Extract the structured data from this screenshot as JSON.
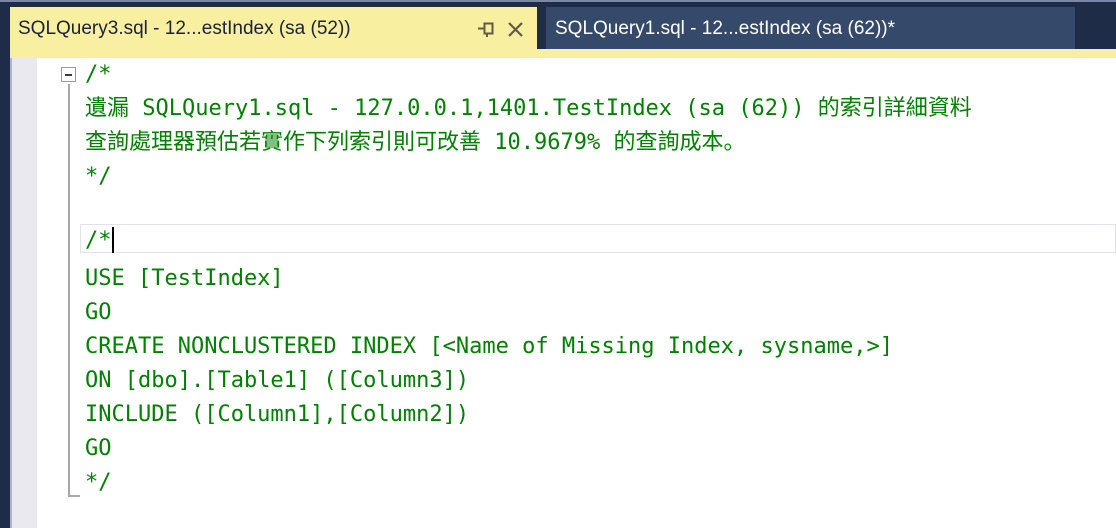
{
  "tabs": [
    {
      "label": "SQLQuery3.sql - 12...estIndex (sa (52))",
      "state": "active",
      "pin_icon": "pin-icon",
      "close_icon": "close-icon"
    },
    {
      "label": "SQLQuery1.sql - 12...estIndex (sa (62))*",
      "state": "inactive"
    }
  ],
  "colors": {
    "active_tab_bg": "#f8efa1",
    "inactive_tab_bg": "#35496b",
    "tab_well_bg": "#1e2c48",
    "comment_green": "#008000",
    "editor_bg": "#ffffff",
    "selection_margin": "#e9e9ef"
  },
  "editor": {
    "language": "sql",
    "fold_marker": "collapsed-minus",
    "improvement_percent": "10.9679%",
    "lines": [
      {
        "text": "/*"
      },
      {
        "text": "遺漏 SQLQuery1.sql - 127.0.0.1,1401.TestIndex (sa (62)) 的索引詳細資料"
      },
      {
        "text": "查詢處理器預估若實作下列索引則可改善 10.9679% 的查詢成本。"
      },
      {
        "text": "*/"
      },
      {
        "text": ""
      },
      {
        "text": "/*"
      },
      {
        "text": "USE [TestIndex]"
      },
      {
        "text": "GO"
      },
      {
        "text": "CREATE NONCLUSTERED INDEX [<Name of Missing Index, sysname,>]"
      },
      {
        "text": "ON [dbo].[Table1] ([Column3])"
      },
      {
        "text": "INCLUDE ([Column1],[Column2])"
      },
      {
        "text": "GO"
      },
      {
        "text": "*/"
      }
    ]
  }
}
